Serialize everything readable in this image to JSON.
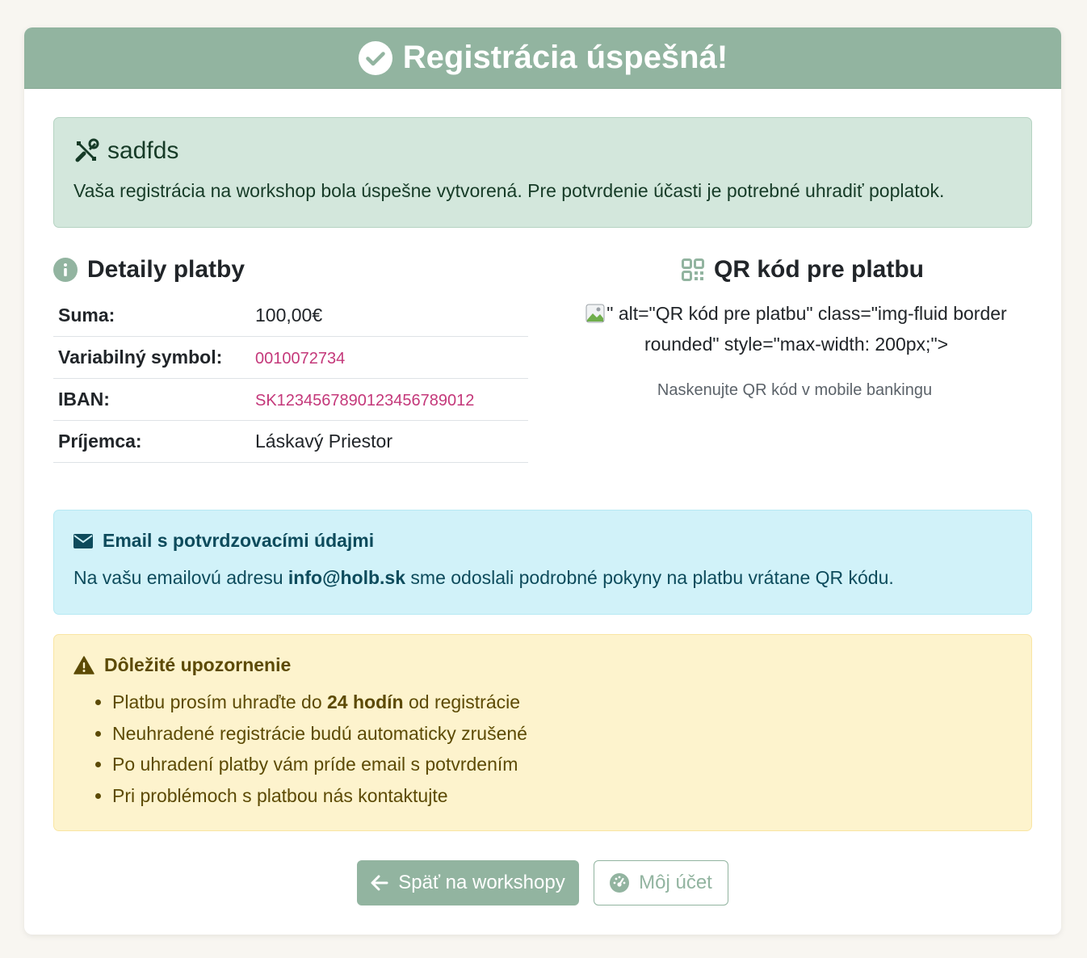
{
  "header": {
    "title": "Registrácia úspešná!",
    "icon": "check-circle-icon"
  },
  "workshop": {
    "name": "sadfds",
    "icon": "tools-icon",
    "message": "Vaša registrácia na workshop bola úspešne vytvorená. Pre potvrdenie účasti je potrebné uhradiť poplatok."
  },
  "payment": {
    "title": "Detaily platby",
    "icon": "info-circle-icon",
    "rows": [
      {
        "label": "Suma:",
        "value": "100,00€"
      },
      {
        "label": "Variabilný symbol:",
        "value": "0010072734"
      },
      {
        "label": "IBAN:",
        "value": "SK1234567890123456789012"
      },
      {
        "label": "Príjemca:",
        "value": "Láskavý Priestor"
      }
    ]
  },
  "qr": {
    "title": "QR kód pre platbu",
    "icon": "qrcode-icon",
    "broken_markup": "\" alt=\"QR kód pre platbu\" class=\"img-fluid border rounded\" style=\"max-width: 200px;\">",
    "note": "Naskenujte QR kód v mobile bankingu"
  },
  "email_alert": {
    "title": "Email s potvrdzovacími údajmi",
    "icon": "envelope-icon",
    "text_before": "Na vašu emailovú adresu ",
    "email": "info@holb.sk",
    "text_after": " sme odoslali podrobné pokyny na platbu vrátane QR kódu."
  },
  "warning": {
    "title": "Dôležité upozornenie",
    "icon": "warning-triangle-icon",
    "item1_before": "Platbu prosím uhraďte do ",
    "item1_bold": "24 hodín",
    "item1_after": " od registrácie",
    "item2": "Neuhradené registrácie budú automaticky zrušené",
    "item3": "Po uhradení platby vám príde email s potvrdením",
    "item4": "Pri problémoch s platbou nás kontaktujte"
  },
  "buttons": {
    "back_label": "Späť na workshopy",
    "back_icon": "arrow-left-icon",
    "account_label": "Môj účet",
    "account_icon": "dashboard-icon"
  },
  "colors": {
    "brand": "#92b4a0",
    "success_bg": "#d3e7dc",
    "info_bg": "#d1f2f9",
    "warning_bg": "#fdf3cd",
    "code": "#c4387a"
  }
}
